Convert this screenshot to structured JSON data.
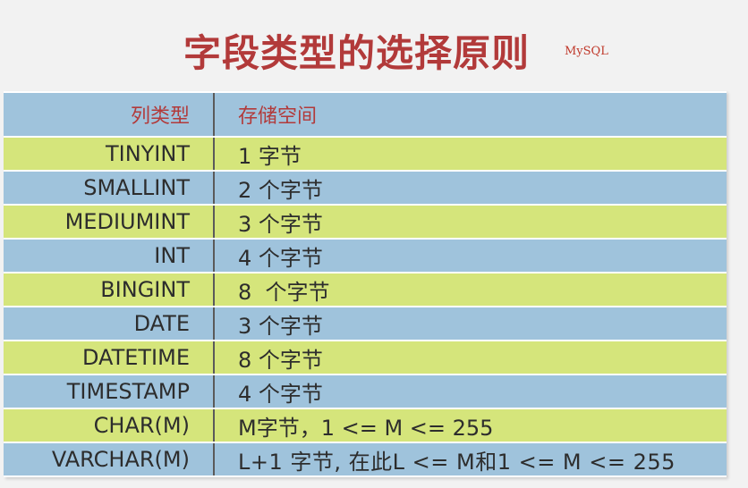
{
  "title": "字段类型的选择原则",
  "brand": "MySQL",
  "table": {
    "headers": {
      "type": "列类型",
      "size": "存储空间"
    },
    "rows": [
      {
        "type": "TINYINT",
        "size": "1 字节"
      },
      {
        "type": "SMALLINT",
        "size": "2 个字节"
      },
      {
        "type": "MEDIUMINT",
        "size": "3 个字节"
      },
      {
        "type": "INT",
        "size": "4 个字节"
      },
      {
        "type": "BINGINT",
        "size": "8  个字节"
      },
      {
        "type": "DATE",
        "size": "3 个字节"
      },
      {
        "type": "DATETIME",
        "size": "8 个字节"
      },
      {
        "type": "TIMESTAMP",
        "size": "4 个字节"
      },
      {
        "type": "CHAR(M)",
        "size": "M字节，1 <= M <= 255"
      },
      {
        "type": "VARCHAR(M)",
        "size": "L+1 字节, 在此L <= M和1 <= M <= 255"
      }
    ]
  },
  "colors": {
    "title": "#b23a3a",
    "row_blue": "#9fc3dc",
    "row_green": "#d5e57b"
  }
}
